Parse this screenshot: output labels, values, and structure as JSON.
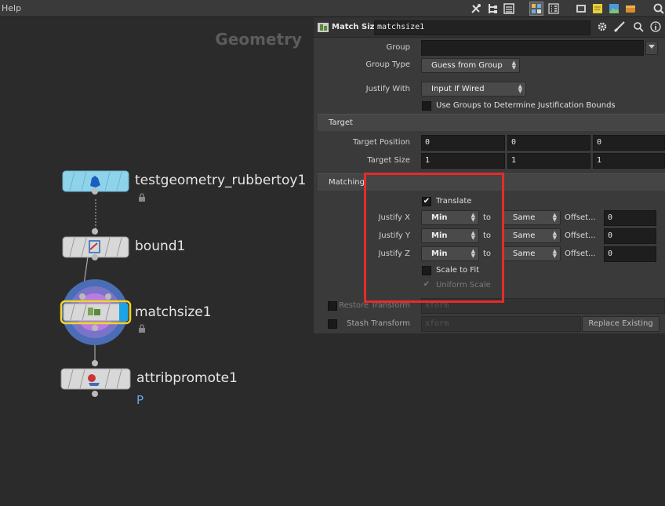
{
  "menubar": {
    "help": "Help"
  },
  "network": {
    "context_title": "Geometry",
    "nodes": [
      {
        "name": "testgeometry_rubbertoy1"
      },
      {
        "name": "bound1"
      },
      {
        "name": "matchsize1"
      },
      {
        "name": "attribpromote1",
        "flag_text": "P"
      }
    ]
  },
  "params": {
    "node_type": "Match Size",
    "node_name": "matchsize1",
    "group": {
      "label": "Group",
      "value": ""
    },
    "group_type": {
      "label": "Group Type",
      "value": "Guess from Group"
    },
    "justify_with": {
      "label": "Justify With",
      "value": "Input If Wired"
    },
    "use_groups": {
      "label": "Use Groups to Determine Justification Bounds",
      "checked": false
    },
    "target_section": "Target",
    "target_position": {
      "label": "Target Position",
      "values": [
        "0",
        "0",
        "0"
      ]
    },
    "target_size": {
      "label": "Target Size",
      "values": [
        "1",
        "1",
        "1"
      ]
    },
    "matching_section": "Matching",
    "translate": {
      "label": "Translate",
      "checked": true
    },
    "justify_x": {
      "label": "Justify X",
      "from": "Min",
      "to_label": "to",
      "to": "Same",
      "offset_label": "Offset...",
      "offset": "0"
    },
    "justify_y": {
      "label": "Justify Y",
      "from": "Min",
      "to_label": "to",
      "to": "Same",
      "offset_label": "Offset...",
      "offset": "0"
    },
    "justify_z": {
      "label": "Justify Z",
      "from": "Min",
      "to_label": "to",
      "to": "Same",
      "offset_label": "Offset...",
      "offset": "0"
    },
    "scale_to_fit": {
      "label": "Scale to Fit",
      "checked": false
    },
    "uniform_scale": {
      "label": "Uniform Scale",
      "checked": true
    },
    "restore_transform": {
      "label": "Restore Transform",
      "value": "xform"
    },
    "stash_transform": {
      "label": "Stash Transform",
      "value": "xform",
      "button": "Replace Existing"
    }
  },
  "colors": {
    "highlight": "#e52b2b",
    "selected_node_outline": "#f2d42a",
    "rubbertoy_node": "#8fd3ea",
    "display_flag": "#1aa3e6"
  }
}
